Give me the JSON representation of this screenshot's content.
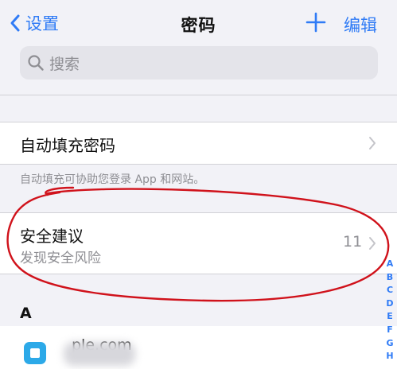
{
  "nav": {
    "back_label": "设置",
    "title": "密码",
    "edit_label": "编辑"
  },
  "search": {
    "placeholder": "搜索"
  },
  "autofill": {
    "label": "自动填充密码",
    "footer": "自动填充可协助您登录 App 和网站。"
  },
  "security": {
    "title": "安全建议",
    "subtitle": "发现安全风险",
    "count": "11"
  },
  "list": {
    "section_header": "A",
    "site_partial": "ple.com"
  },
  "index": [
    "A",
    "B",
    "C",
    "D",
    "E",
    "F",
    "G",
    "H"
  ],
  "colors": {
    "accent": "#2f7bf6",
    "annotation": "#d0121b",
    "background": "#f2f2f7"
  }
}
